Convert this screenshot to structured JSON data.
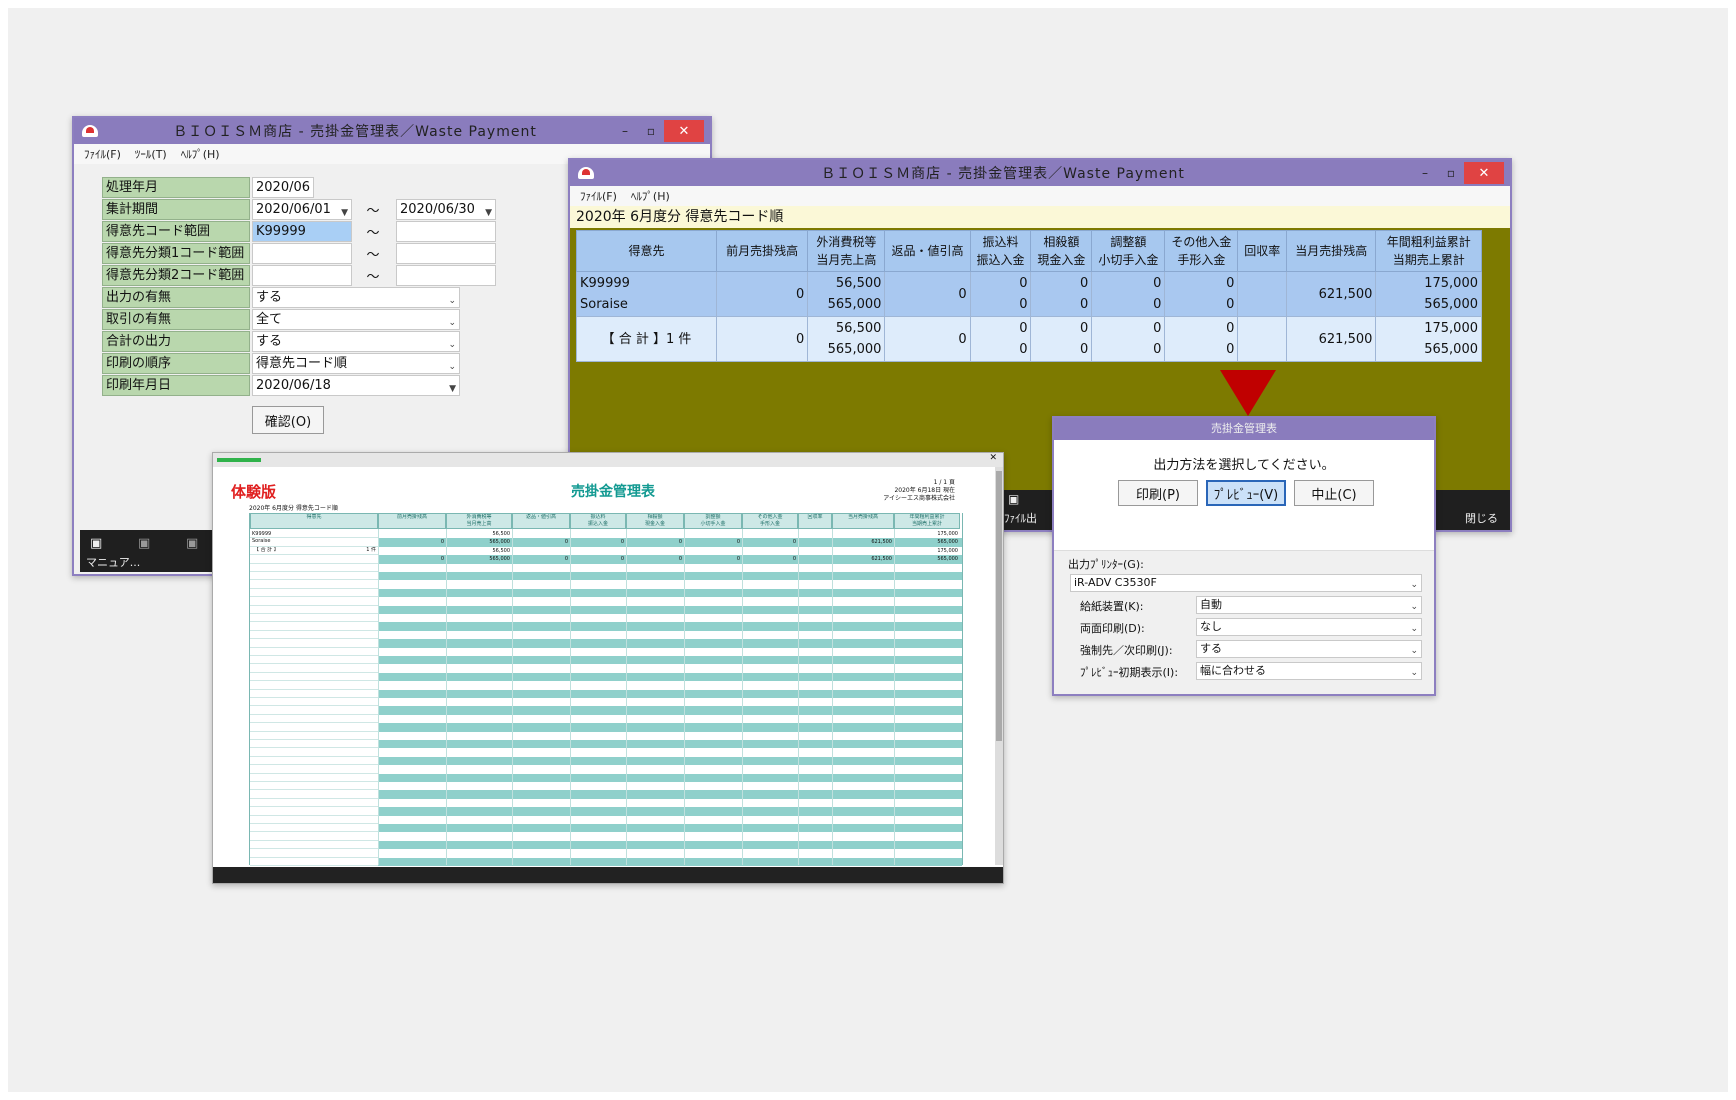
{
  "form_window": {
    "title": "ＢＩＯＩＳＭ商店  - 売掛金管理表／Waste Payment",
    "menu": [
      "ﾌｧｲﾙ(F)",
      "ﾂｰﾙ(T)",
      "ﾍﾙﾌﾟ(H)"
    ],
    "fields": {
      "month_label": "処理年月",
      "month_value": "2020/06",
      "period_label": "集計期間",
      "period_from": "2020/06/01",
      "period_to": "2020/06/30",
      "client_range_label": "得意先コード範囲",
      "client_range_from": "K99999",
      "class1_label": "得意先分類1コード範囲",
      "class2_label": "得意先分類2コード範囲",
      "output_flag_label": "出力の有無",
      "output_flag_value": "する",
      "transaction_label": "取引の有無",
      "transaction_value": "全て",
      "total_label": "合計の出力",
      "total_value": "する",
      "order_label": "印刷の順序",
      "order_value": "得意先コード順",
      "print_date_label": "印刷年月日",
      "print_date_value": "2020/06/18",
      "tilde": "～"
    },
    "confirm_button": "確認(O)",
    "taskbar_label": "マニュア..."
  },
  "list_window": {
    "title": "ＢＩＯＩＳＭ商店  - 売掛金管理表／Waste Payment",
    "menu": [
      "ﾌｧｲﾙ(F)",
      "ﾍﾙﾌﾟ(H)"
    ],
    "subtitle": "2020年 6月度分    得意先コード順",
    "headers": [
      "得意先",
      "前月売掛残高",
      "外消費税等\n当月売上高",
      "返品・値引高",
      "振込料\n振込入金",
      "相殺額\n現金入金",
      "調整額\n小切手入金",
      "その他入金\n手形入金",
      "回収率",
      "当月売掛残高",
      "年間粗利益累計\n当期売上累計"
    ],
    "rows": [
      {
        "client_code": "K99999",
        "client_name": "Soraise",
        "prev": "0",
        "tax": "56,500",
        "sales": "565,000",
        "returns": "0",
        "fee": "0",
        "transfer": "0",
        "offset": "0",
        "cash": "0",
        "adjust": "0",
        "check": "0",
        "other": "0",
        "bill": "0",
        "rate": "",
        "balance": "621,500",
        "gross": "175,000",
        "annual": "565,000"
      },
      {
        "client_code": "【 合  計 】1 件",
        "client_name": "",
        "prev": "0",
        "tax": "56,500",
        "sales": "565,000",
        "returns": "0",
        "fee": "0",
        "transfer": "0",
        "offset": "0",
        "cash": "0",
        "adjust": "0",
        "check": "0",
        "other": "0",
        "bill": "0",
        "rate": "",
        "balance": "621,500",
        "gross": "175,000",
        "annual": "565,000"
      }
    ],
    "taskbar_left": "ﾌｧｲﾙ出",
    "taskbar_right": "閉じる"
  },
  "dialog": {
    "title": "売掛金管理表",
    "prompt": "出力方法を選択してください。",
    "buttons": [
      "印刷(P)",
      "ﾌﾟﾚﾋﾞｭｰ(V)",
      "中止(C)"
    ],
    "printer_label": "出力ﾌﾟﾘﾝﾀｰ(G):",
    "printer_value": "iR-ADV C3530F",
    "options": [
      {
        "label": "給紙装置(K):",
        "value": "自動"
      },
      {
        "label": "両面印刷(D):",
        "value": "なし"
      },
      {
        "label": "強制先／次印刷(J):",
        "value": "する"
      },
      {
        "label": "ﾌﾟﾚﾋﾞｭｰ初期表示(I):",
        "value": "幅に合わせる"
      }
    ]
  },
  "report_window": {
    "trial_label": "体験版",
    "title": "売掛金管理表",
    "page": "1 / 1 頁",
    "date": "2020年 6月18日 現在",
    "company": "アイシーエス商事株式会社",
    "subtitle": "2020年 6月度分   得意先コード順",
    "headers": [
      "得意先",
      "前月売掛残高",
      "外消費税等\n当月売上高",
      "返品・値引高",
      "振込料\n振込入金",
      "相殺額\n現金入金",
      "調整額\n小切手入金",
      "その他入金\n手形入金",
      "回収率",
      "当月売掛残高",
      "年間粗利益累計\n当期売上累計"
    ],
    "row_client_code": "K99999",
    "row_client_name": "Soraise",
    "row_total_label": "【  合  計  】",
    "row_total_count": "1 件",
    "values_a": [
      "",
      "56,500",
      "",
      "",
      "",
      "",
      "",
      "",
      "",
      "175,000"
    ],
    "values_b": [
      "0",
      "565,000",
      "0",
      "0",
      "0",
      "0",
      "0",
      "",
      "621,500",
      "565,000"
    ]
  },
  "colors": {
    "title_bar": "#8a7cbd",
    "label_bg": "#b9d7ad",
    "grid_header": "#a7c8ef",
    "olive": "#7d7a00",
    "teal": "#8fd0cb",
    "arrow": "#c00000",
    "trial_red": "#e02020"
  }
}
